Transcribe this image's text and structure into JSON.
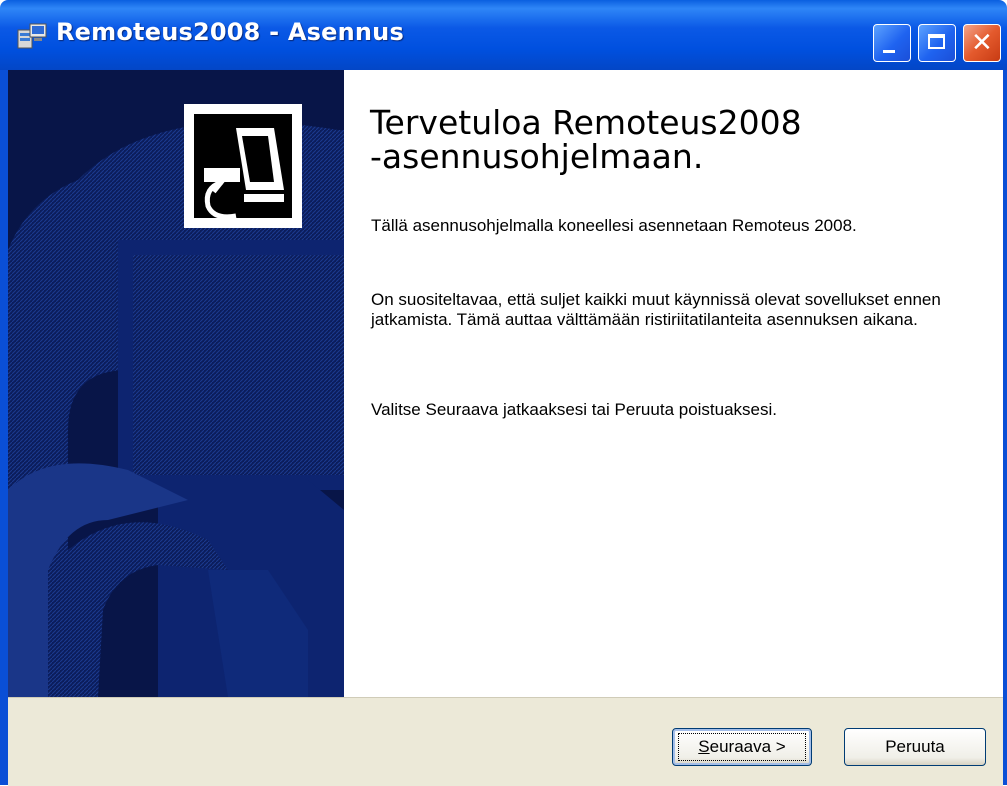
{
  "window": {
    "title": "Remoteus2008 - Asennus",
    "controls": [
      "minimize",
      "maximize",
      "close"
    ],
    "title_icon": "installer-icon"
  },
  "welcome": {
    "title": "Tervetuloa Remoteus2008\n-asennusohjelmaan.",
    "paragraphs": [
      "Tällä asennusohjelmalla koneellesi asennetaan Remoteus 2008.",
      "On suositeltavaa, että suljet kaikki muut käynnissä olevat sovellukset ennen jatkamista. Tämä auttaa välttämään ristiriitatilanteita asennuksen aikana.",
      "Valitse Seuraava jatkaaksesi tai Peruuta poistuaksesi."
    ]
  },
  "buttons": {
    "next_mnemonic": "S",
    "next_rest": "euraava >",
    "cancel": "Peruuta"
  },
  "colors": {
    "titlebar": "#0054e3",
    "banner": "#0a1a52",
    "bottom_bar": "#ece9d8"
  }
}
